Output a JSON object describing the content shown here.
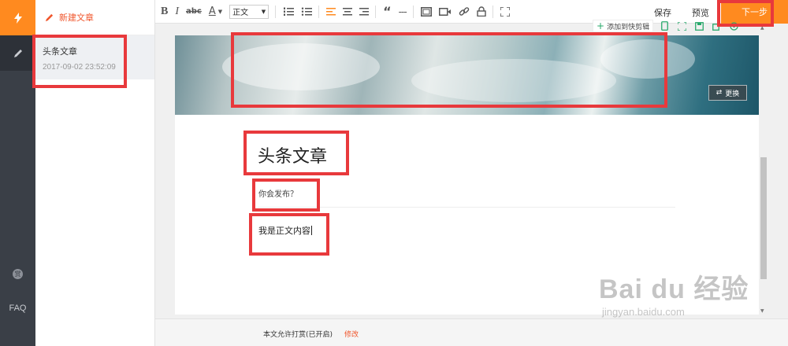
{
  "sidebar": {
    "faq": "FAQ",
    "reward_icon_text": "赏"
  },
  "article_list": {
    "new_article": "新建文章",
    "items": [
      {
        "title": "头条文章",
        "date": "2017-09-02 23:52:09"
      }
    ]
  },
  "toolbar": {
    "bold": "B",
    "italic": "I",
    "strike": "abc",
    "font_color": "A",
    "format_select": "正文",
    "quote": "“",
    "hr": "---",
    "save": "保存",
    "preview": "预览",
    "next": "下一步"
  },
  "editor": {
    "quick_add": "添加到快剪辑",
    "replace_cover": "更换",
    "title": "头条文章",
    "abstract": "你会发布？",
    "body": "我是正文内容"
  },
  "bottom": {
    "reward_status": "本文允许打赏(已开启)",
    "modify": "修改"
  },
  "watermark": {
    "logo": "Bai du 经验",
    "url": "jingyan.baidu.com"
  },
  "colors": {
    "accent": "#ff8a1f",
    "link": "#f0562c",
    "annotation": "#e8393c",
    "rail": "#3a3f47"
  }
}
